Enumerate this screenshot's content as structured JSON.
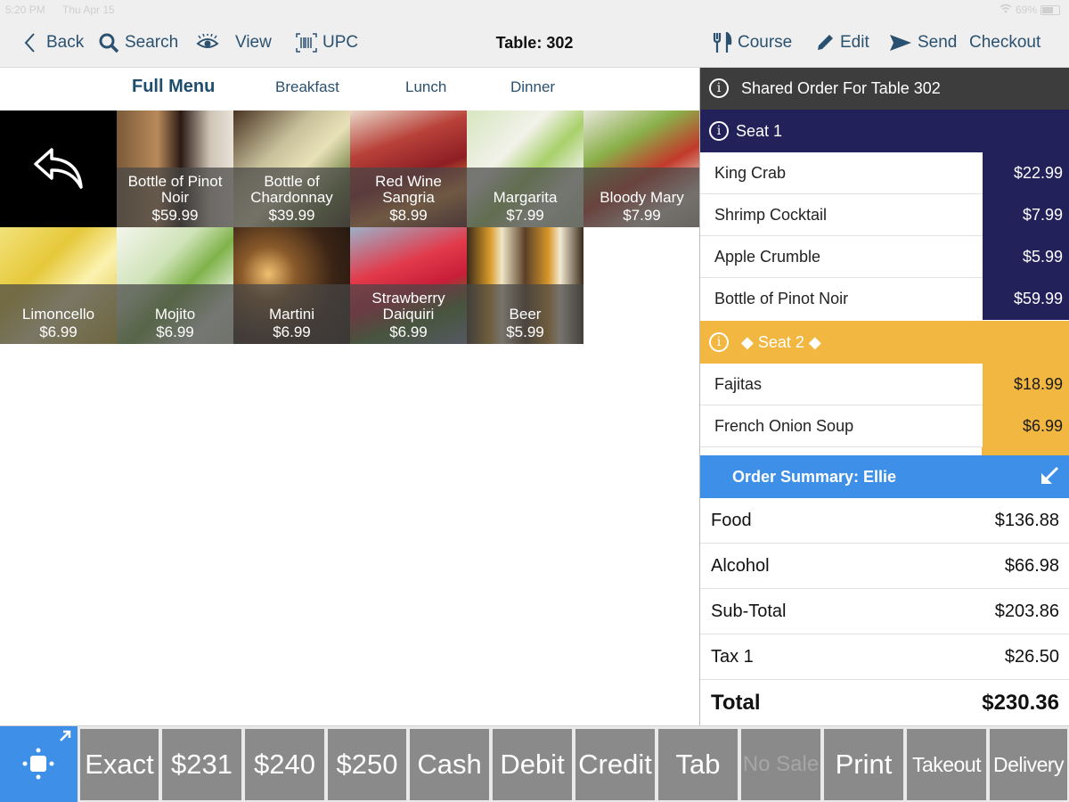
{
  "status": {
    "time": "5:20 PM",
    "date": "Thu Apr 15",
    "battery": "69%"
  },
  "nav": {
    "back": "Back",
    "search": "Search",
    "view": "View",
    "upc": "UPC",
    "title": "Table: 302",
    "course": "Course",
    "edit": "Edit",
    "send": "Send",
    "checkout": "Checkout"
  },
  "tabs": [
    "Full Menu",
    "Breakfast",
    "Lunch",
    "Dinner"
  ],
  "tiles": [
    {
      "name": "Bottle of Pinot Noir",
      "price": "$59.99"
    },
    {
      "name": "Bottle of Chardonnay",
      "price": "$39.99"
    },
    {
      "name": "Red Wine Sangria",
      "price": "$8.99"
    },
    {
      "name": "Margarita",
      "price": "$7.99"
    },
    {
      "name": "Bloody Mary",
      "price": "$7.99"
    },
    {
      "name": "Limoncello",
      "price": "$6.99"
    },
    {
      "name": "Mojito",
      "price": "$6.99"
    },
    {
      "name": "Martini",
      "price": "$6.99"
    },
    {
      "name": "Strawberry Daiquiri",
      "price": "$6.99"
    },
    {
      "name": "Beer",
      "price": "$5.99"
    }
  ],
  "order": {
    "header": "Shared Order For Table 302",
    "seat1": {
      "label": "Seat 1",
      "items": [
        {
          "name": "King Crab",
          "price": "$22.99"
        },
        {
          "name": "Shrimp Cocktail",
          "price": "$7.99"
        },
        {
          "name": "Apple Crumble",
          "price": "$5.99"
        },
        {
          "name": "Bottle of Pinot Noir",
          "price": "$59.99"
        }
      ]
    },
    "seat2": {
      "label": "◆ Seat 2 ◆",
      "items": [
        {
          "name": "Fajitas",
          "price": "$18.99"
        },
        {
          "name": "French Onion Soup",
          "price": "$6.99"
        }
      ]
    }
  },
  "summary": {
    "title": "Order Summary: Ellie",
    "rows": [
      {
        "label": "Food",
        "value": "$136.88"
      },
      {
        "label": "Alcohol",
        "value": "$66.98"
      },
      {
        "label": "Sub-Total",
        "value": "$203.86"
      },
      {
        "label": "Tax 1",
        "value": "$26.50"
      },
      {
        "label": "Total",
        "value": "$230.36"
      }
    ]
  },
  "payment_buttons": [
    "Exact",
    "$231",
    "$240",
    "$250",
    "Cash",
    "Debit",
    "Credit",
    "Tab",
    "No Sale",
    "Print",
    "Takeout",
    "Delivery"
  ],
  "colors": {
    "navy": "#23215a",
    "gold": "#f2b740",
    "blue": "#3d8fe8",
    "dark": "#3d3d3d",
    "button": "#8a8a8a",
    "nav_text": "#2a5170"
  }
}
